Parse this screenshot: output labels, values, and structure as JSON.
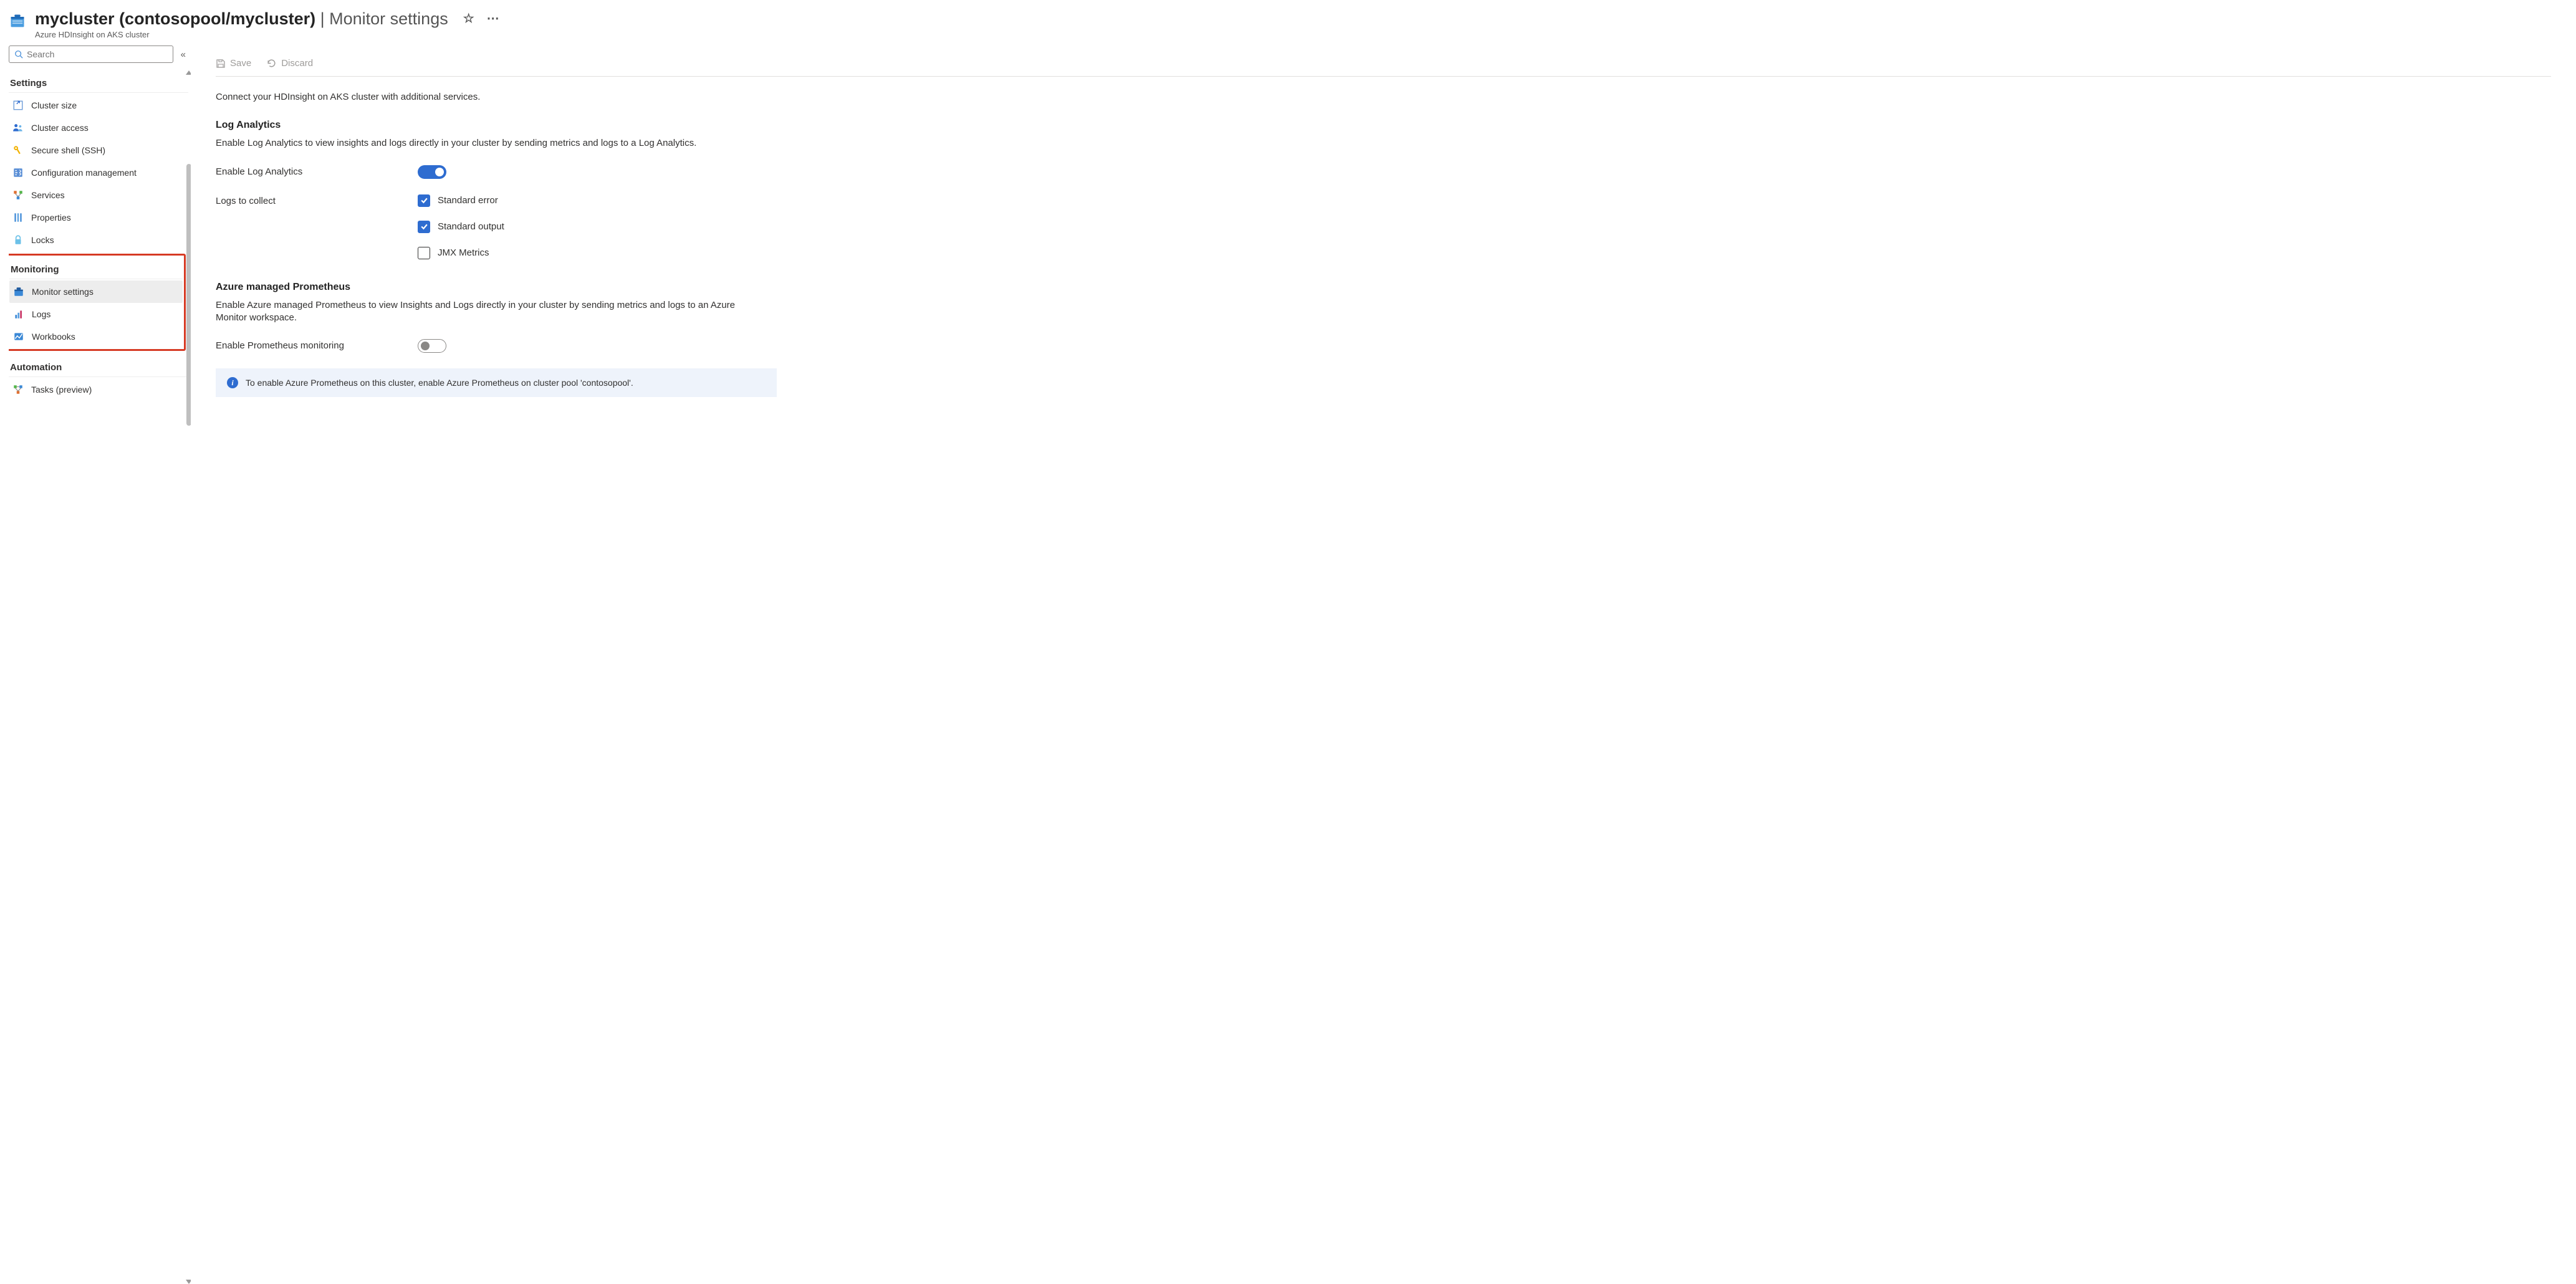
{
  "header": {
    "title_main": "mycluster (contosopool/mycluster)",
    "title_sub": "Monitor settings",
    "subtitle": "Azure HDInsight on AKS cluster"
  },
  "search": {
    "placeholder": "Search"
  },
  "sidebar": {
    "settings_heading": "Settings",
    "settings_items": [
      {
        "label": "Cluster size"
      },
      {
        "label": "Cluster access"
      },
      {
        "label": "Secure shell (SSH)"
      },
      {
        "label": "Configuration management"
      },
      {
        "label": "Services"
      },
      {
        "label": "Properties"
      },
      {
        "label": "Locks"
      }
    ],
    "monitoring_heading": "Monitoring",
    "monitoring_items": [
      {
        "label": "Monitor settings",
        "active": true
      },
      {
        "label": "Logs"
      },
      {
        "label": "Workbooks"
      }
    ],
    "automation_heading": "Automation",
    "automation_items": [
      {
        "label": "Tasks (preview)"
      }
    ]
  },
  "toolbar": {
    "save_label": "Save",
    "discard_label": "Discard"
  },
  "main": {
    "connect_text": "Connect your HDInsight on AKS cluster with additional services.",
    "log_analytics": {
      "heading": "Log Analytics",
      "desc": "Enable Log Analytics to view insights and logs directly in your cluster by sending metrics and logs to a Log Analytics.",
      "enable_label": "Enable Log Analytics",
      "enable_on": true,
      "collect_label": "Logs to collect",
      "options": [
        {
          "label": "Standard error",
          "checked": true
        },
        {
          "label": "Standard output",
          "checked": true
        },
        {
          "label": "JMX Metrics",
          "checked": false
        }
      ]
    },
    "prometheus": {
      "heading": "Azure managed Prometheus",
      "desc": "Enable Azure managed Prometheus to view Insights and Logs directly in your cluster by sending metrics and logs to an Azure Monitor workspace.",
      "enable_label": "Enable Prometheus monitoring",
      "enable_on": false,
      "info": "To enable Azure Prometheus on this cluster, enable Azure Prometheus on cluster pool 'contosopool'."
    }
  }
}
